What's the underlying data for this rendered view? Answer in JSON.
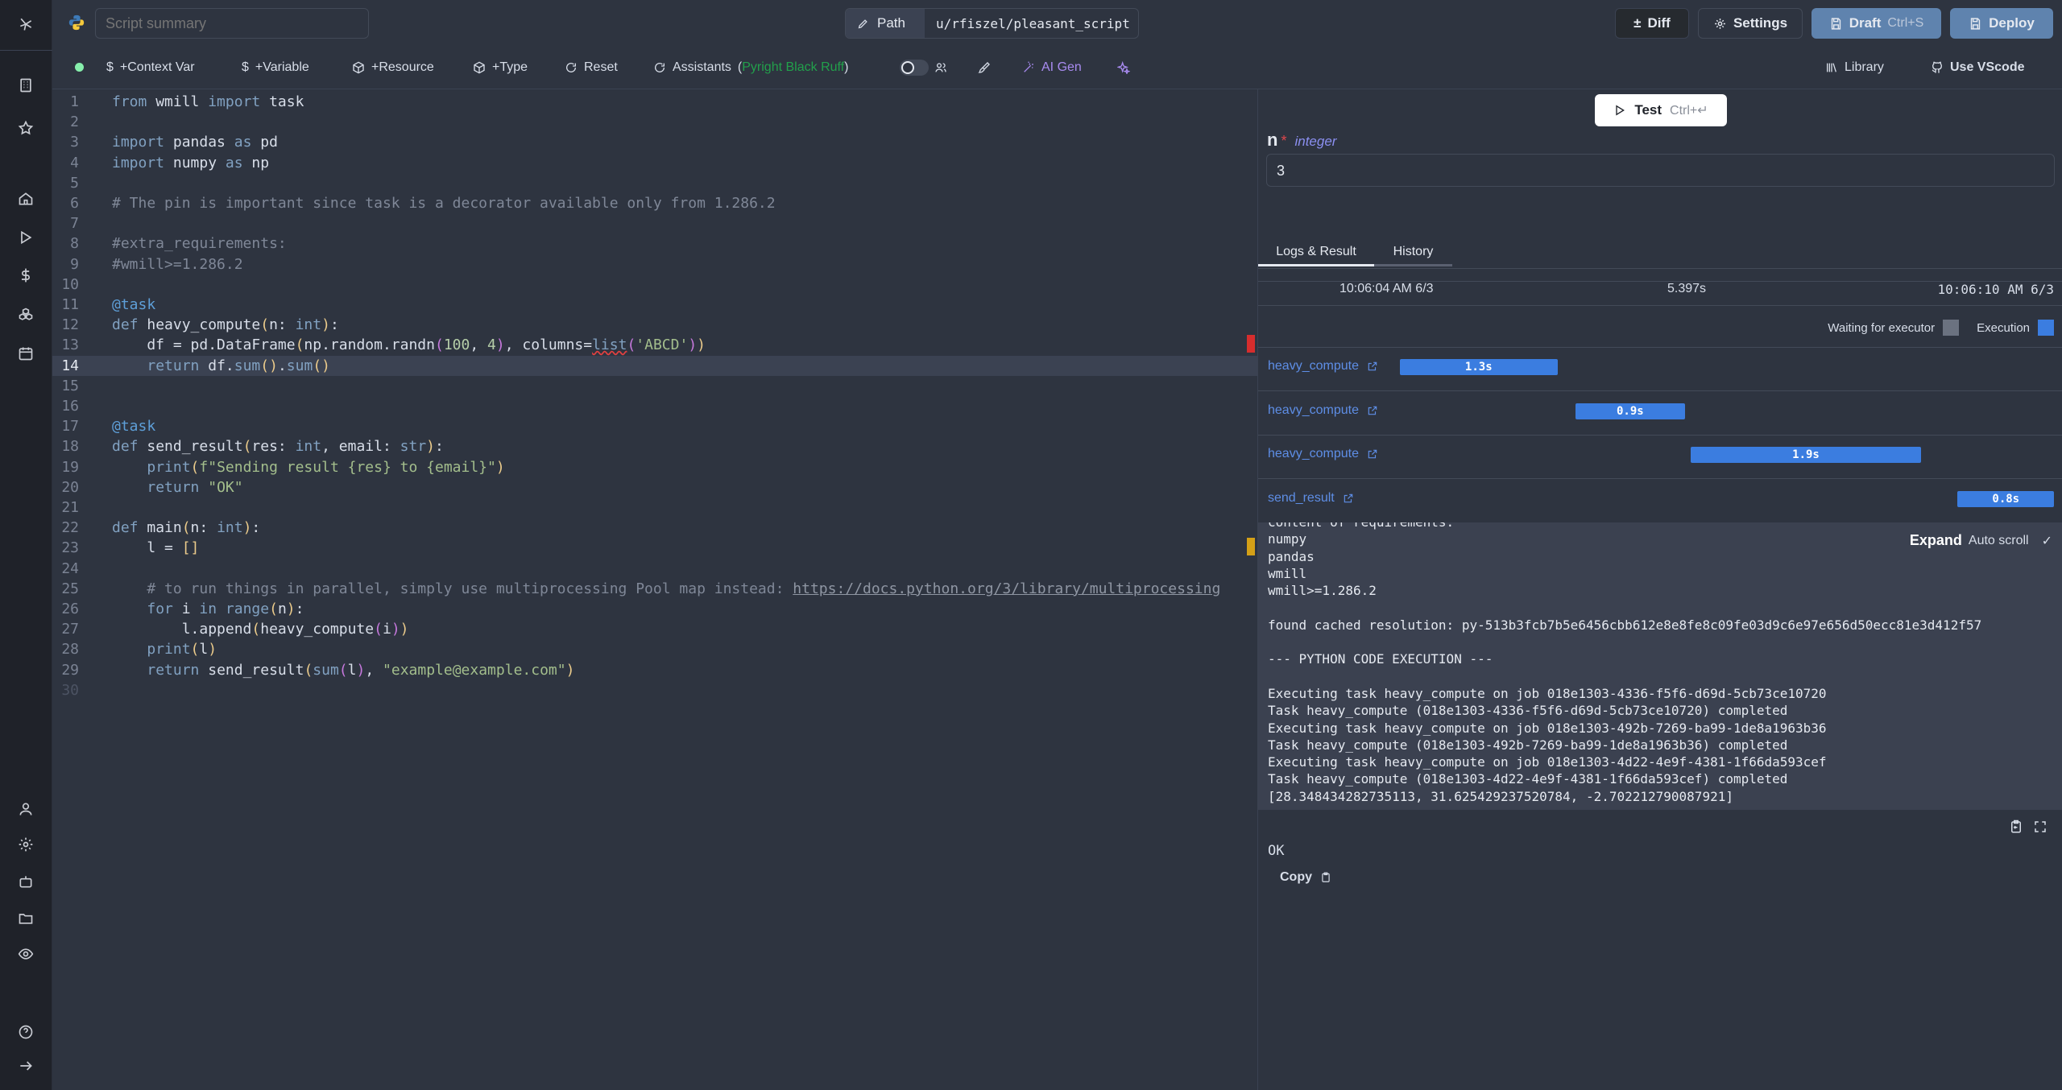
{
  "header": {
    "summary_placeholder": "Script summary",
    "path_label": "Path",
    "path_value": "u/rfiszel/pleasant_script",
    "diff": "Diff",
    "settings": "Settings",
    "draft": "Draft",
    "draft_shortcut": "Ctrl+S",
    "deploy": "Deploy"
  },
  "toolbar": {
    "context_var": "+Context Var",
    "variable": "+Variable",
    "resource": "+Resource",
    "type": "+Type",
    "reset": "Reset",
    "assistants": "Assistants",
    "assistants_list": "Pyright Black Ruff",
    "paren_open": "(",
    "paren_close": ")",
    "ai_gen": "AI Gen",
    "library": "Library",
    "use_vscode": "Use VScode"
  },
  "editor": {
    "current_line": 14,
    "lines": [
      [
        [
          "k",
          "from"
        ],
        [
          "t",
          " wmill "
        ],
        [
          "k",
          "import"
        ],
        [
          "t",
          " task"
        ]
      ],
      [],
      [
        [
          "k",
          "import"
        ],
        [
          "t",
          " pandas "
        ],
        [
          "k",
          "as"
        ],
        [
          "t",
          " pd"
        ]
      ],
      [
        [
          "k",
          "import"
        ],
        [
          "t",
          " numpy "
        ],
        [
          "k",
          "as"
        ],
        [
          "t",
          " np"
        ]
      ],
      [],
      [
        [
          "c",
          "# The pin is important since task is a decorator available only from 1.286.2"
        ]
      ],
      [],
      [
        [
          "c",
          "#extra_requirements:"
        ]
      ],
      [
        [
          "c",
          "#wmill>=1.286.2"
        ]
      ],
      [],
      [
        [
          "d",
          "@task"
        ]
      ],
      [
        [
          "k",
          "def"
        ],
        [
          "t",
          " heavy_compute"
        ],
        [
          "y",
          "("
        ],
        [
          "t",
          "n: "
        ],
        [
          "k",
          "int"
        ],
        [
          "y",
          ")"
        ],
        [
          "t",
          ":"
        ]
      ],
      [
        [
          "t",
          "    df = pd.DataFrame"
        ],
        [
          "y",
          "("
        ],
        [
          "t",
          "np.random.randn"
        ],
        [
          "p",
          "("
        ],
        [
          "n",
          "100"
        ],
        [
          "t",
          ", "
        ],
        [
          "n",
          "4"
        ],
        [
          "p",
          ")"
        ],
        [
          "t",
          ", columns="
        ],
        [
          "e",
          "list"
        ],
        [
          "p",
          "("
        ],
        [
          "s",
          "'ABCD'"
        ],
        [
          "p",
          ")"
        ],
        [
          "y",
          ")"
        ]
      ],
      [
        [
          "t",
          "    "
        ],
        [
          "k",
          "return"
        ],
        [
          "t",
          " df."
        ],
        [
          "k",
          "sum"
        ],
        [
          "y",
          "()"
        ],
        [
          "t",
          "."
        ],
        [
          "k",
          "sum"
        ],
        [
          "y",
          "()"
        ]
      ],
      [],
      [],
      [
        [
          "d",
          "@task"
        ]
      ],
      [
        [
          "k",
          "def"
        ],
        [
          "t",
          " send_result"
        ],
        [
          "y",
          "("
        ],
        [
          "t",
          "res: "
        ],
        [
          "k",
          "int"
        ],
        [
          "t",
          ", email: "
        ],
        [
          "k",
          "str"
        ],
        [
          "y",
          ")"
        ],
        [
          "t",
          ":"
        ]
      ],
      [
        [
          "t",
          "    "
        ],
        [
          "k",
          "print"
        ],
        [
          "y",
          "("
        ],
        [
          "s",
          "f\"Sending result {res} to {email}\""
        ],
        [
          "y",
          ")"
        ]
      ],
      [
        [
          "t",
          "    "
        ],
        [
          "k",
          "return"
        ],
        [
          "t",
          " "
        ],
        [
          "s",
          "\"OK\""
        ]
      ],
      [],
      [
        [
          "k",
          "def"
        ],
        [
          "t",
          " main"
        ],
        [
          "y",
          "("
        ],
        [
          "t",
          "n: "
        ],
        [
          "k",
          "int"
        ],
        [
          "y",
          ")"
        ],
        [
          "t",
          ":"
        ]
      ],
      [
        [
          "t",
          "    l = "
        ],
        [
          "y",
          "[]"
        ]
      ],
      [],
      [
        [
          "c",
          "    # to run things in parallel, simply use multiprocessing Pool map instead: "
        ],
        [
          "u",
          "https://docs.python.org/3/library/multiprocessing"
        ]
      ],
      [
        [
          "t",
          "    "
        ],
        [
          "k",
          "for"
        ],
        [
          "t",
          " i "
        ],
        [
          "k",
          "in"
        ],
        [
          "t",
          " "
        ],
        [
          "k",
          "range"
        ],
        [
          "y",
          "("
        ],
        [
          "t",
          "n"
        ],
        [
          "y",
          ")"
        ],
        [
          "t",
          ":"
        ]
      ],
      [
        [
          "t",
          "        l.append"
        ],
        [
          "y",
          "("
        ],
        [
          "t",
          "heavy_compute"
        ],
        [
          "p",
          "("
        ],
        [
          "t",
          "i"
        ],
        [
          "p",
          ")"
        ],
        [
          "y",
          ")"
        ]
      ],
      [
        [
          "t",
          "    "
        ],
        [
          "k",
          "print"
        ],
        [
          "y",
          "("
        ],
        [
          "t",
          "l"
        ],
        [
          "y",
          ")"
        ]
      ],
      [
        [
          "t",
          "    "
        ],
        [
          "k",
          "return"
        ],
        [
          "t",
          " send_result"
        ],
        [
          "y",
          "("
        ],
        [
          "k",
          "sum"
        ],
        [
          "p",
          "("
        ],
        [
          "t",
          "l"
        ],
        [
          "p",
          ")"
        ],
        [
          "t",
          ", "
        ],
        [
          "s",
          "\"example@example.com\""
        ],
        [
          "y",
          ")"
        ]
      ],
      []
    ]
  },
  "test": {
    "label": "Test",
    "shortcut": "Ctrl+↵"
  },
  "args": {
    "name": "n",
    "required_mark": "*",
    "type": "integer",
    "value": "3"
  },
  "tabs": [
    {
      "label": "Logs & Result",
      "active": true
    },
    {
      "label": "History",
      "active": false
    }
  ],
  "timeline": {
    "start": "10:06:04 AM 6/3",
    "duration": "5.397s",
    "end": "10:06:10 AM 6/3",
    "legend_waiting": "Waiting for executor",
    "legend_execution": "Execution",
    "colors": {
      "waiting": "#6b7280",
      "execution": "#3b7de0"
    },
    "jobs": [
      {
        "name": "heavy_compute",
        "duration": "1.3s",
        "start_s": 0.0,
        "dur_s": 1.3
      },
      {
        "name": "heavy_compute",
        "duration": "0.9s",
        "start_s": 1.45,
        "dur_s": 0.9
      },
      {
        "name": "heavy_compute",
        "duration": "1.9s",
        "start_s": 2.4,
        "dur_s": 1.9
      },
      {
        "name": "send_result",
        "duration": "0.8s",
        "start_s": 4.6,
        "dur_s": 0.8
      }
    ]
  },
  "logs": {
    "expand": "Expand",
    "auto_scroll": "Auto scroll",
    "lines": [
      "content of requirements:",
      "numpy",
      "pandas",
      "wmill",
      "wmill>=1.286.2",
      "",
      "found cached resolution: py-513b3fcb7b5e6456cbb612e8e8fe8c09fe03d9c6e97e656d50ecc81e3d412f57",
      "",
      "--- PYTHON CODE EXECUTION ---",
      "",
      "Executing task heavy_compute on job 018e1303-4336-f5f6-d69d-5cb73ce10720",
      "Task heavy_compute (018e1303-4336-f5f6-d69d-5cb73ce10720) completed",
      "Executing task heavy_compute on job 018e1303-492b-7269-ba99-1de8a1963b36",
      "Task heavy_compute (018e1303-492b-7269-ba99-1de8a1963b36) completed",
      "Executing task heavy_compute on job 018e1303-4d22-4e9f-4381-1f66da593cef",
      "Task heavy_compute (018e1303-4d22-4e9f-4381-1f66da593cef) completed",
      "[28.348434282735113, 31.625429237520784, -2.702212790087921]"
    ]
  },
  "result": {
    "value": "OK",
    "copy": "Copy"
  }
}
